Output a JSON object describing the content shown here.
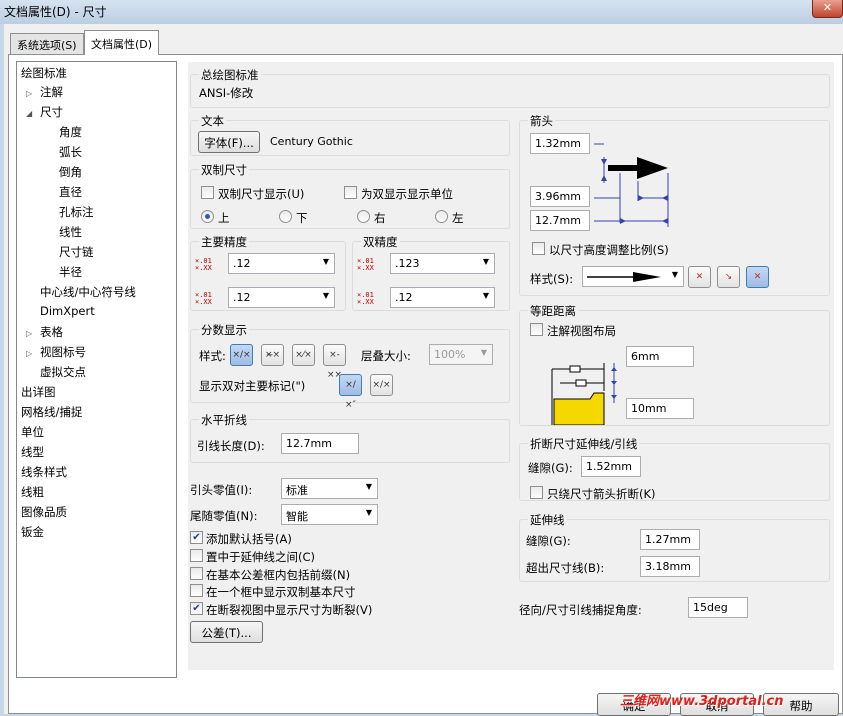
{
  "window": {
    "title": "文档属性(D) - 尺寸",
    "close_label": "✕"
  },
  "tabs": [
    {
      "label": "系统选项(S)"
    },
    {
      "label": "文档属性(D)"
    }
  ],
  "tree": {
    "items": [
      {
        "label": "绘图标准"
      },
      {
        "label": "注解"
      },
      {
        "label": "尺寸"
      },
      {
        "label": "角度"
      },
      {
        "label": "弧长"
      },
      {
        "label": "倒角"
      },
      {
        "label": "直径"
      },
      {
        "label": "孔标注"
      },
      {
        "label": "线性"
      },
      {
        "label": "尺寸链"
      },
      {
        "label": "半径"
      },
      {
        "label": "中心线/中心符号线"
      },
      {
        "label": "DimXpert"
      },
      {
        "label": "表格"
      },
      {
        "label": "视图标号"
      },
      {
        "label": "虚拟交点"
      },
      {
        "label": "出详图"
      },
      {
        "label": "网格线/捕捉"
      },
      {
        "label": "单位"
      },
      {
        "label": "线型"
      },
      {
        "label": "线条样式"
      },
      {
        "label": "线粗"
      },
      {
        "label": "图像品质"
      },
      {
        "label": "钣金"
      }
    ]
  },
  "overall_standard": {
    "title": "总绘图标准",
    "value": "ANSI-修改"
  },
  "text": {
    "title": "文本",
    "font_button": "字体(F)...",
    "font_name": "Century Gothic"
  },
  "dual": {
    "title": "双制尺寸",
    "show_dual": "双制尺寸显示(U)",
    "show_units": "为双显示显示单位",
    "pos_top": "上",
    "pos_bottom": "下",
    "pos_right": "右",
    "pos_left": "左"
  },
  "primary_precision": {
    "title": "主要精度",
    "value1": ".12",
    "value2": ".12"
  },
  "dual_precision": {
    "title": "双精度",
    "value1": ".123",
    "value2": ".12"
  },
  "fraction": {
    "title": "分数显示",
    "style_label": "样式:",
    "stack_label": "层叠大小:",
    "stack_value": "100%",
    "dual_label": "显示双对主要标记(\")"
  },
  "horizontal_break": {
    "title": "水平折线",
    "leader_label": "引线长度(D):",
    "leader_value": "12.7mm"
  },
  "leading_zero": {
    "label": "引头零值(I):",
    "value": "标准"
  },
  "trailing_zero": {
    "label": "尾随零值(N):",
    "value": "智能"
  },
  "options": [
    {
      "label": "添加默认括号(A)",
      "checked": true
    },
    {
      "label": "置中于延伸线之间(C)",
      "checked": false
    },
    {
      "label": "在基本公差框内包括前缀(N)",
      "checked": false
    },
    {
      "label": "在一个框中显示双制基本尺寸",
      "checked": false
    },
    {
      "label": "在断裂视图中显示尺寸为断裂(V)",
      "checked": true
    }
  ],
  "tolerance_button": "公差(T)...",
  "arrows": {
    "title": "箭头",
    "v1": "1.32mm",
    "v2": "3.96mm",
    "v3": "12.7mm",
    "scale_label": "以尺寸高度调整比例(S)",
    "style_label": "样式(S):"
  },
  "offset": {
    "title": "等距距离",
    "layout_label": "注解视图布局",
    "v1": "6mm",
    "v2": "10mm"
  },
  "break_ext": {
    "title": "折断尺寸延伸线/引线",
    "gap_label": "缝隙(G):",
    "gap_value": "1.52mm",
    "only_arrow_label": "只绕尺寸箭头折断(K)"
  },
  "extension": {
    "title": "延伸线",
    "gap_label": "缝隙(G):",
    "gap_value": "1.27mm",
    "beyond_label": "超出尺寸线(B):",
    "beyond_value": "3.18mm"
  },
  "radial": {
    "label": "径向/尺寸引线捕捉角度:",
    "value": "15deg"
  },
  "bottom_buttons": {
    "ok": "确定",
    "cancel": "取消",
    "help": "帮助"
  },
  "watermark": "三维网www.3dportal.cn",
  "colors": {
    "selection": "#3399ff",
    "accent": "#2a5bb8"
  }
}
